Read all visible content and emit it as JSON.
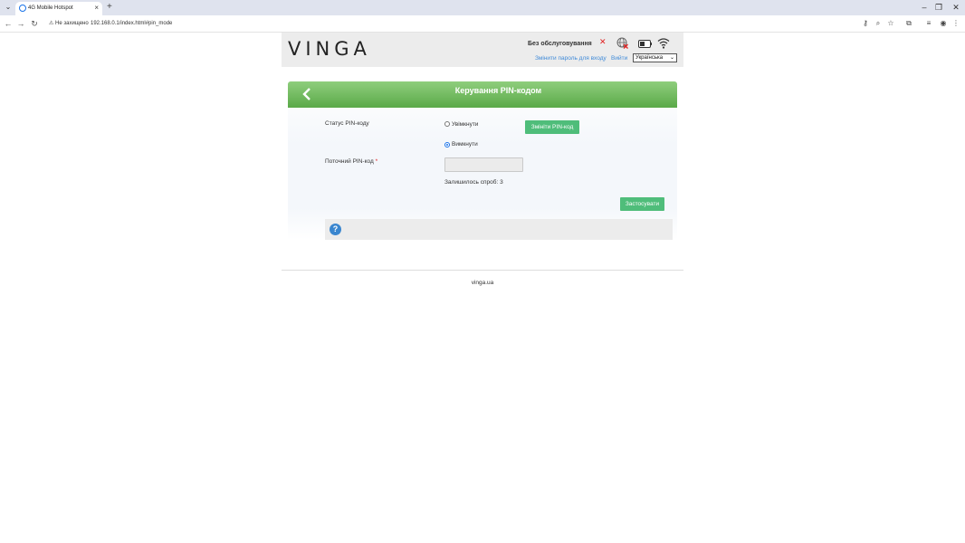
{
  "browser": {
    "tab_title": "4G Mobile Hotspot",
    "not_secure_label": "Не захищено",
    "url": "192.168.0.1/index.html#pin_mode"
  },
  "header": {
    "logo": "VINGA",
    "service_status": "Без обслуговування",
    "change_password_link": "Змінити пароль для входу",
    "logout_link": "Вийти",
    "language_selected": "Українська"
  },
  "panel": {
    "title": "Керування PIN-кодом",
    "pin_status_label": "Статус PIN-коду",
    "radio_on_label": "Увімкнути",
    "radio_off_label": "Вимкнути",
    "selected_option": "off",
    "change_pin_button": "Змініти PIN-код",
    "current_pin_label": "Поточний PIN-код",
    "required_mark": "*",
    "attempts_text": "Залишилось спроб: 3",
    "apply_button": "Застосувати"
  },
  "footer": {
    "text": "vinga.ua"
  },
  "colors": {
    "accent_green": "#5aa948",
    "button_green": "#4fbd7a",
    "link_blue": "#3f8ad8",
    "error_red": "#e02020"
  }
}
